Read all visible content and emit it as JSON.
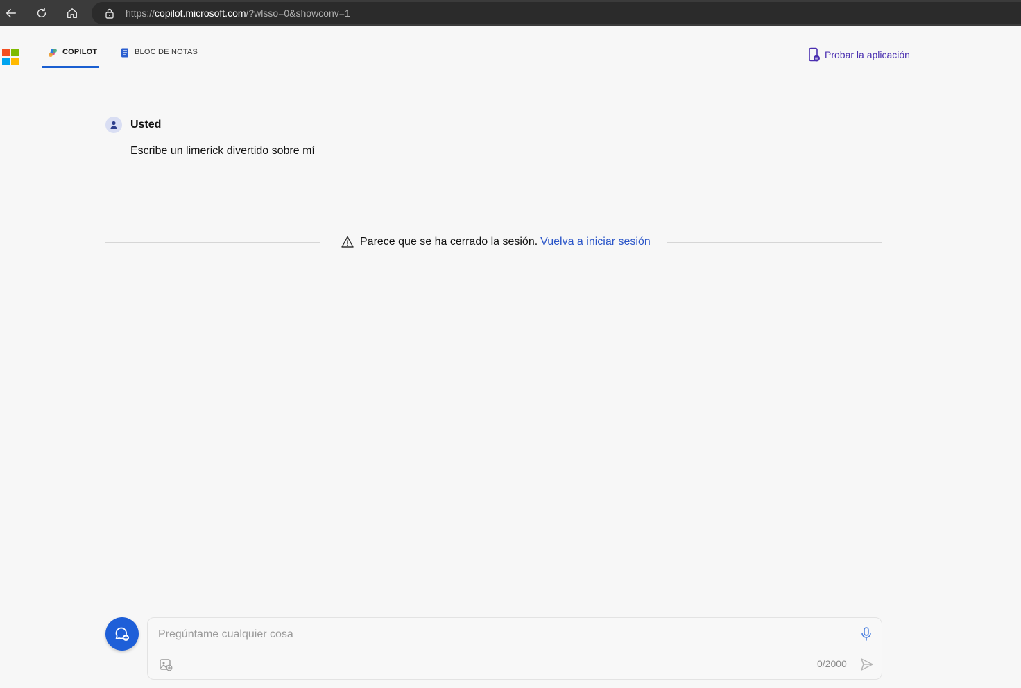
{
  "browser": {
    "url_prefix": "https://",
    "url_host": "copilot.microsoft.com",
    "url_path": "/?wlsso=0&showconv=1"
  },
  "nav": {
    "tabs": [
      {
        "label": "COPILOT",
        "active": true
      },
      {
        "label": "BLOC DE NOTAS",
        "active": false
      }
    ],
    "try_app_label": "Probar la aplicación"
  },
  "conversation": {
    "user_name": "Usted",
    "user_message": "Escribe un limerick divertido sobre mí"
  },
  "notice": {
    "text": "Parece que se ha cerrado la sesión.",
    "link": "Vuelva a iniciar sesión"
  },
  "composer": {
    "placeholder": "Pregúntame cualquier cosa",
    "char_count": "0/2000"
  },
  "colors": {
    "accent": "#1e5fd8",
    "link": "#2a55c8",
    "try_app": "#4a2fb0",
    "ms_red": "#f25022",
    "ms_green": "#7fba00",
    "ms_blue": "#00a4ef",
    "ms_yellow": "#ffb900"
  }
}
